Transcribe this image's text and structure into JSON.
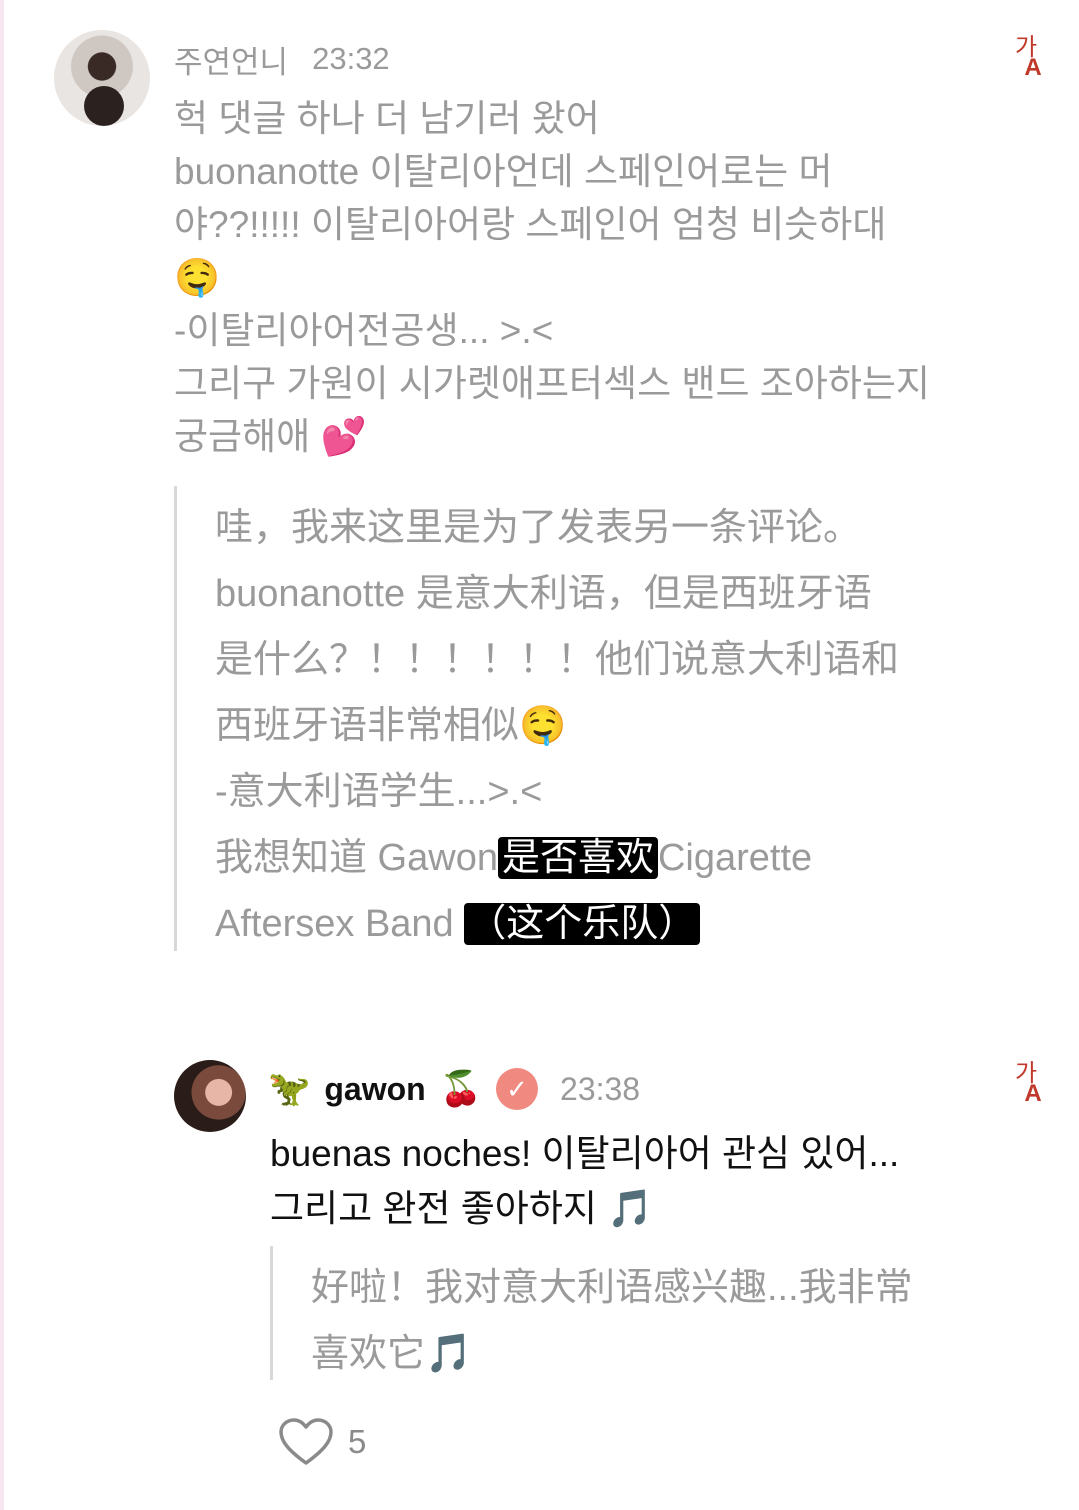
{
  "comment1": {
    "author": "주연언니",
    "time": "23:32",
    "body": [
      "헉 댓글 하나 더 남기러 왔어",
      "buonanotte 이탈리아언데 스페인어로는 머",
      "야??!!!!! 이탈리아어랑 스페인어 엄청 비슷하대",
      "🤤",
      "-이탈리아어전공생... >.<",
      "그리구 가원이 시가렛애프터섹스 밴드 조아하는지",
      "궁금해애 💕"
    ],
    "translation": {
      "lines": [
        "哇，我来这里是为了发表另一条评论。",
        "buonanotte 是意大利语，但是西班牙语",
        "是什么？！！！！！！他们说意大利语和",
        "西班牙语非常相似🤤",
        "-意大利语学生...>.<"
      ],
      "line6_before": "我想知道 Gawon",
      "line6_overlay": "是否喜欢",
      "line6_after": "Cigarette",
      "line7_before": "Aftersex Band",
      "line7_overlay": "（这个乐队）"
    }
  },
  "comment2": {
    "emoji_prefix": "🦖",
    "author": "gawon",
    "emoji_suffix": "🍒",
    "verified_mark": "✓",
    "time": "23:38",
    "body": [
      "buenas noches! 이탈리아어 관심 있어...",
      "그리고 완전 좋아하지 🎵"
    ],
    "translation": [
      "好啦！我对意大利语感兴趣...我非常",
      "喜欢它🎵"
    ]
  },
  "translate_icon": {
    "top": "가",
    "bottom": "A"
  },
  "like": {
    "icon": "heart-icon",
    "count": "5"
  },
  "colors": {
    "accent": "#c0392b",
    "verified": "#f08a80",
    "muted": "#9a9a9a"
  }
}
